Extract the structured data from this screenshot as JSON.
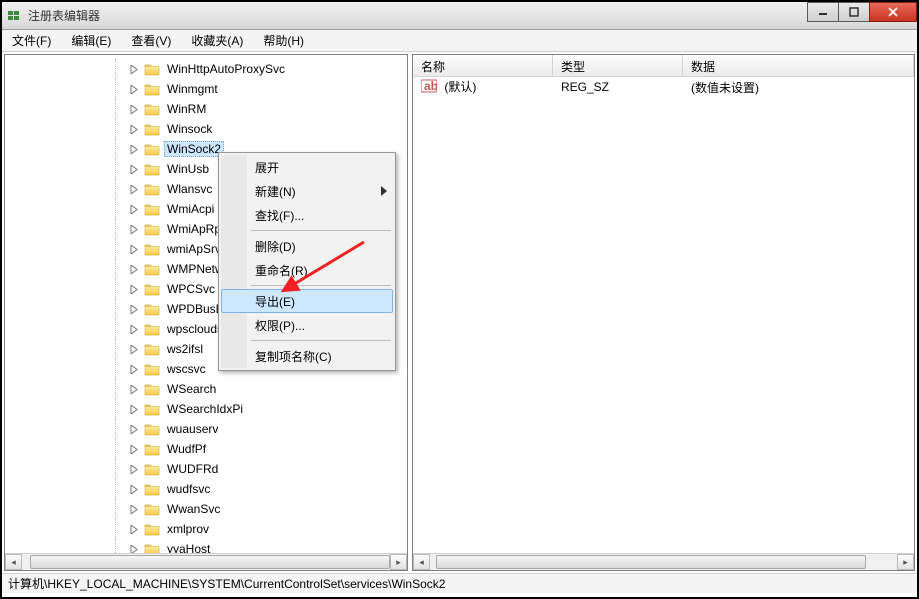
{
  "window": {
    "title": "注册表编辑器"
  },
  "menubar": [
    "文件(F)",
    "编辑(E)",
    "查看(V)",
    "收藏夹(A)",
    "帮助(H)"
  ],
  "tree": {
    "items": [
      {
        "label": "WinHttpAutoProxySvc"
      },
      {
        "label": "Winmgmt"
      },
      {
        "label": "WinRM"
      },
      {
        "label": "Winsock"
      },
      {
        "label": "WinSock2",
        "selected": true
      },
      {
        "label": "WinUsb"
      },
      {
        "label": "Wlansvc"
      },
      {
        "label": "WmiAcpi"
      },
      {
        "label": "WmiApRpl"
      },
      {
        "label": "wmiApSrv"
      },
      {
        "label": "WMPNetworkSvc"
      },
      {
        "label": "WPCSvc"
      },
      {
        "label": "WPDBusEnum"
      },
      {
        "label": "wpscloudsvr"
      },
      {
        "label": "ws2ifsl"
      },
      {
        "label": "wscsvc"
      },
      {
        "label": "WSearch"
      },
      {
        "label": "WSearchIdxPi"
      },
      {
        "label": "wuauserv"
      },
      {
        "label": "WudfPf"
      },
      {
        "label": "WUDFRd"
      },
      {
        "label": "wudfsvc"
      },
      {
        "label": "WwanSvc"
      },
      {
        "label": "xmlprov"
      },
      {
        "label": "yyaHost"
      }
    ]
  },
  "list": {
    "headers": {
      "name": "名称",
      "type": "类型",
      "data": "数据"
    },
    "rows": [
      {
        "name": "(默认)",
        "type": "REG_SZ",
        "data": "(数值未设置)"
      }
    ]
  },
  "context_menu": {
    "items": [
      {
        "label": "展开",
        "submenu": false
      },
      {
        "label": "新建(N)",
        "submenu": true
      },
      {
        "label": "查找(F)...",
        "submenu": false
      },
      {
        "sep": true
      },
      {
        "label": "删除(D)",
        "submenu": false
      },
      {
        "label": "重命名(R)",
        "submenu": false
      },
      {
        "sep": true
      },
      {
        "label": "导出(E)",
        "submenu": false,
        "highlight": true
      },
      {
        "label": "权限(P)...",
        "submenu": false
      },
      {
        "sep": true
      },
      {
        "label": "复制项名称(C)",
        "submenu": false
      }
    ]
  },
  "statusbar": {
    "path": "计算机\\HKEY_LOCAL_MACHINE\\SYSTEM\\CurrentControlSet\\services\\WinSock2"
  }
}
